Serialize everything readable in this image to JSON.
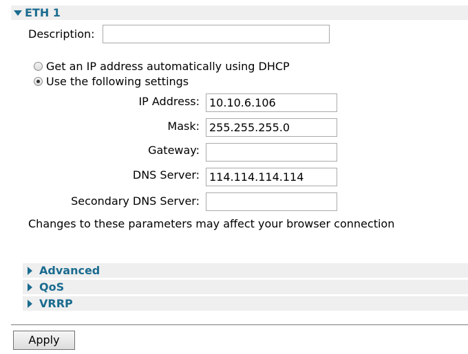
{
  "sections": {
    "eth1": {
      "title": "ETH 1",
      "expanded": true
    },
    "advanced": {
      "title": "Advanced",
      "expanded": false
    },
    "qos": {
      "title": "QoS",
      "expanded": false
    },
    "vrrp": {
      "title": "VRRP",
      "expanded": false
    }
  },
  "description": {
    "label": "Description:",
    "value": ""
  },
  "ip_mode": {
    "options": [
      {
        "label": "Get an IP address automatically using DHCP",
        "selected": false
      },
      {
        "label": "Use the following settings",
        "selected": true
      }
    ]
  },
  "fields": {
    "ip_address": {
      "label": "IP Address:",
      "value": "10.10.6.106"
    },
    "mask": {
      "label": "Mask:",
      "value": "255.255.255.0"
    },
    "gateway": {
      "label": "Gateway:",
      "value": ""
    },
    "dns_server": {
      "label": "DNS Server:",
      "value": "114.114.114.114"
    },
    "secondary_dns": {
      "label": "Secondary DNS Server:",
      "value": ""
    }
  },
  "notice": "Changes to these parameters may affect your browser connection",
  "apply_label": "Apply",
  "colors": {
    "section_text": "#1a6b8f",
    "section_bg": "#efefef"
  },
  "icons": {
    "expanded": "triangle-down-icon",
    "collapsed": "triangle-right-icon"
  }
}
